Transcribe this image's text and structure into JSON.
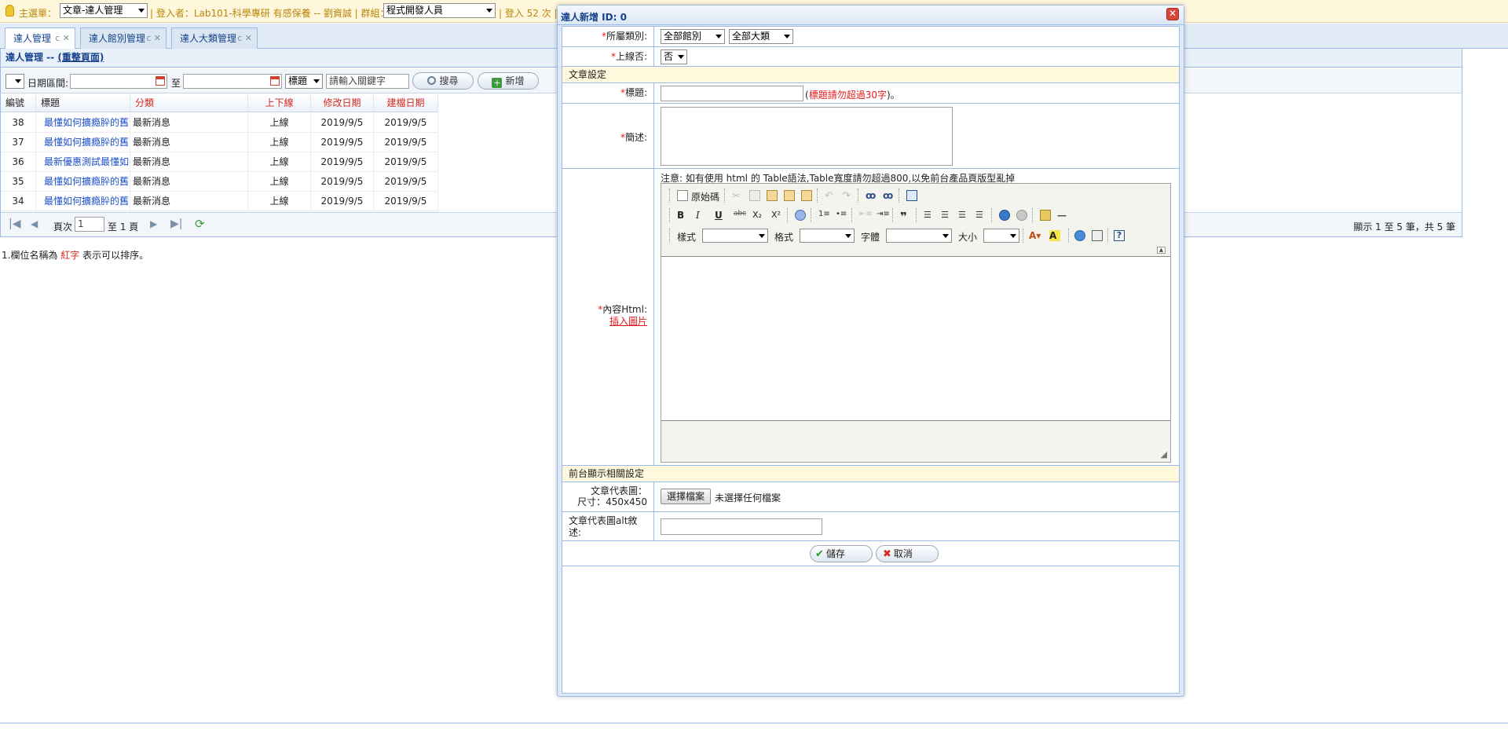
{
  "topbar": {
    "main_menu_label": "主選單：",
    "main_menu_value": "文章-達人管理",
    "login_text": "| 登入者：Lab101-科學專研 有感保養 -- 劉資誠 | 群組：",
    "group_value": "程式開發人員",
    "login_count_text": "| 登入 52 次 |"
  },
  "tabs": [
    {
      "label": "達人管理"
    },
    {
      "label": "達人館別管理"
    },
    {
      "label": "達人大類管理"
    }
  ],
  "panel": {
    "title": "達人管理 -- ",
    "reload_link": "(重整頁面)"
  },
  "toolbar": {
    "date_range_label": "日期區間:",
    "to_label": "至",
    "field_select": "標題",
    "keyword_placeholder": "請輸入關鍵字",
    "search_button": "搜尋",
    "add_button": "新增"
  },
  "grid": {
    "headers": [
      "編號",
      "標題",
      "分類",
      "上下線",
      "修改日期",
      "建檔日期"
    ],
    "rows": [
      {
        "id": "38",
        "title": "最懂如何擴瘾肸的舊",
        "category": "最新消息",
        "online": "上線",
        "modified": "2019/9/5",
        "created": "2019/9/5"
      },
      {
        "id": "37",
        "title": "最懂如何擴瘾肸的舊",
        "category": "最新消息",
        "online": "上線",
        "modified": "2019/9/5",
        "created": "2019/9/5"
      },
      {
        "id": "36",
        "title": "最新優惠測試最懂如",
        "category": "最新消息",
        "online": "上線",
        "modified": "2019/9/5",
        "created": "2019/9/5"
      },
      {
        "id": "35",
        "title": "最懂如何擴瘾肸的舊",
        "category": "最新消息",
        "online": "上線",
        "modified": "2019/9/5",
        "created": "2019/9/5"
      },
      {
        "id": "34",
        "title": "最懂如何擴瘾肸的舊",
        "category": "最新消息",
        "online": "上線",
        "modified": "2019/9/5",
        "created": "2019/9/5"
      }
    ]
  },
  "pager": {
    "page_label": "頁次",
    "page_value": "1",
    "of_label": "至 1 頁",
    "summary": "顯示 1 至 5 筆，共 5 筆"
  },
  "note": {
    "prefix": "1.欄位名稱為 ",
    "red": "紅字",
    "suffix": " 表示可以排序。"
  },
  "dialog": {
    "title": "達人新增 ID: 0",
    "category_label": "所屬類別:",
    "category_hall": "全部館別",
    "category_major": "全部大類",
    "online_label": "上線否:",
    "online_value": "否",
    "section_article": "文章設定",
    "title_label": "標題:",
    "title_hint": "標題請勿超過30字",
    "title_hint_paren_open": "(",
    "title_hint_paren_close": ")。",
    "summary_label": "簡述:",
    "content_notice": "注意: 如有使用 html 的 Table語法,Table寬度請勿超過800,以免前台產品頁版型亂掉",
    "content_label": "內容Html:",
    "insert_image_link": "插入圖片",
    "editor": {
      "source_label": "原始碼",
      "style_label": "樣式",
      "format_label": "格式",
      "font_label": "字體",
      "size_label": "大小"
    },
    "section_frontend": "前台顯示相關設定",
    "image_label": "文章代表圖：",
    "image_size": "尺寸：450x450",
    "choose_file_button": "選擇檔案",
    "no_file_text": "未選擇任何檔案",
    "alt_label": "文章代表圖alt敘述:",
    "save_button": "儲存",
    "cancel_button": "取消"
  }
}
